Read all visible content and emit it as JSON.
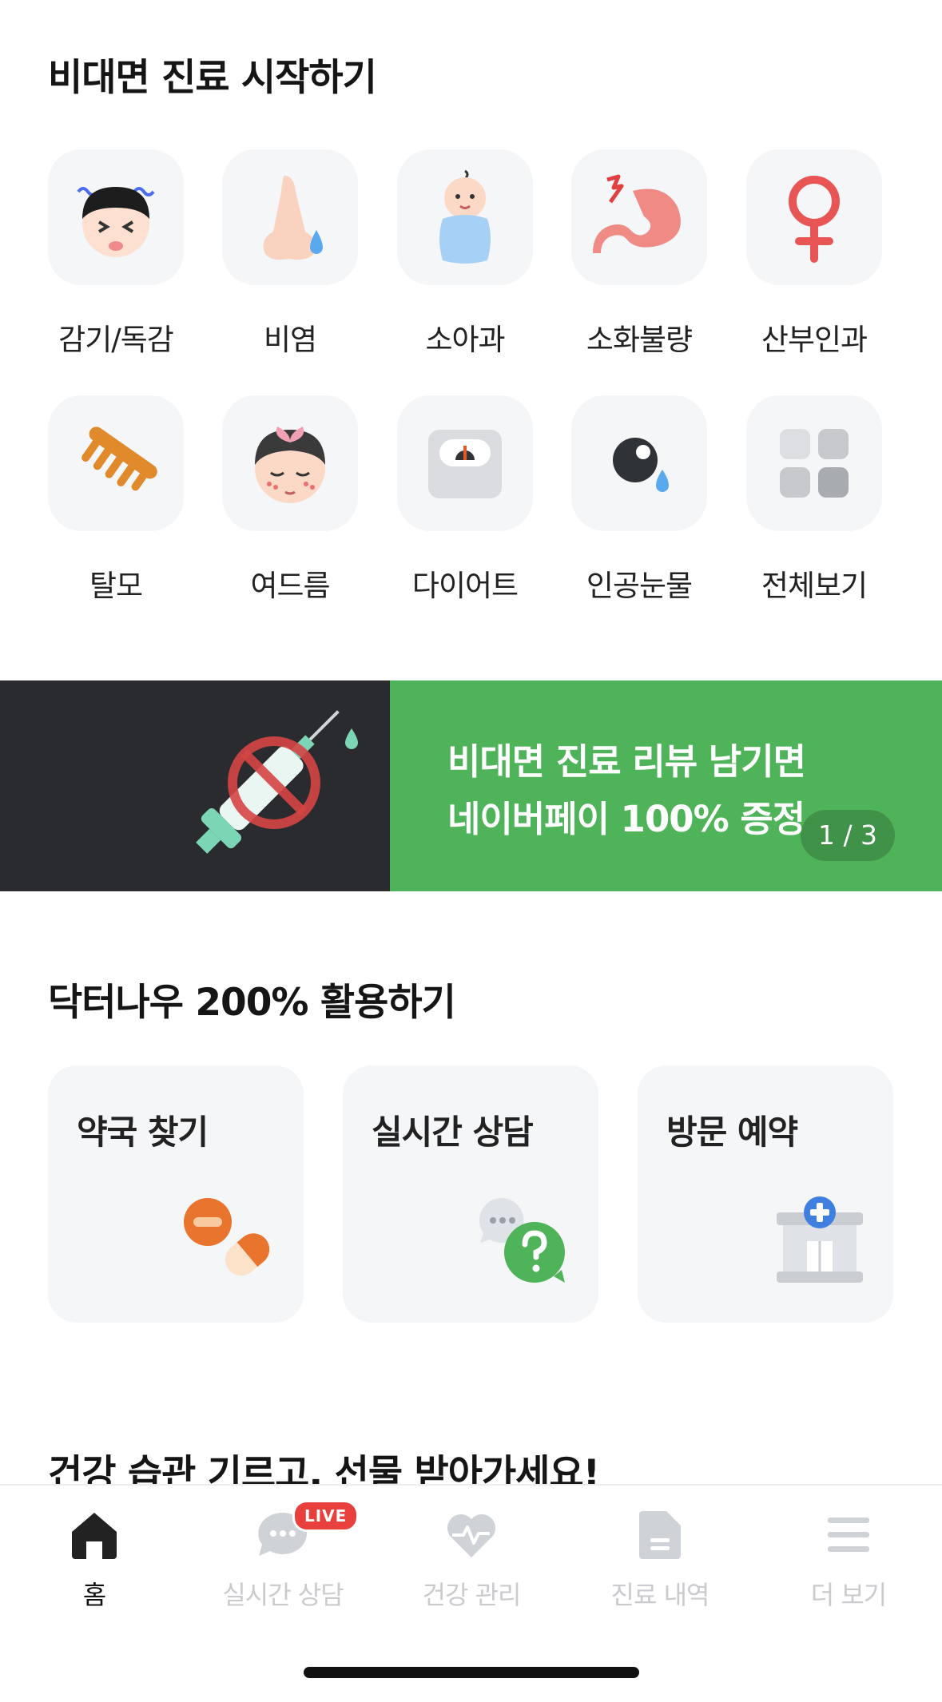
{
  "start_section": {
    "title": "비대면 진료 시작하기"
  },
  "categories": [
    {
      "label": "감기/독감",
      "icon": "sick-face-icon"
    },
    {
      "label": "비염",
      "icon": "nose-icon"
    },
    {
      "label": "소아과",
      "icon": "baby-icon"
    },
    {
      "label": "소화불량",
      "icon": "stomach-icon"
    },
    {
      "label": "산부인과",
      "icon": "female-symbol-icon"
    },
    {
      "label": "탈모",
      "icon": "comb-icon"
    },
    {
      "label": "여드름",
      "icon": "acne-face-icon"
    },
    {
      "label": "다이어트",
      "icon": "scale-icon"
    },
    {
      "label": "인공눈물",
      "icon": "eye-drop-icon"
    },
    {
      "label": "전체보기",
      "icon": "grid-icon"
    }
  ],
  "banner": {
    "line1": "비대면 진료 리뷰 남기면",
    "line2": "네이버페이 100% 증정",
    "pager": "1 / 3",
    "accent": "#4fb35a"
  },
  "features_section": {
    "title": "닥터나우 200% 활용하기"
  },
  "features": [
    {
      "label": "약국 찾기",
      "icon": "pill-icon"
    },
    {
      "label": "실시간 상담",
      "icon": "question-chat-icon"
    },
    {
      "label": "방문 예약",
      "icon": "hospital-icon"
    }
  ],
  "habit_section": {
    "title": "건강 습관 기르고, 선물 받아가세요!"
  },
  "tabbar": {
    "items": [
      {
        "label": "홈",
        "icon": "home-icon",
        "active": true
      },
      {
        "label": "실시간 상담",
        "icon": "chat-icon",
        "badge": "LIVE"
      },
      {
        "label": "건강 관리",
        "icon": "heart-pulse-icon"
      },
      {
        "label": "진료 내역",
        "icon": "document-icon"
      },
      {
        "label": "더 보기",
        "icon": "menu-icon"
      }
    ]
  }
}
